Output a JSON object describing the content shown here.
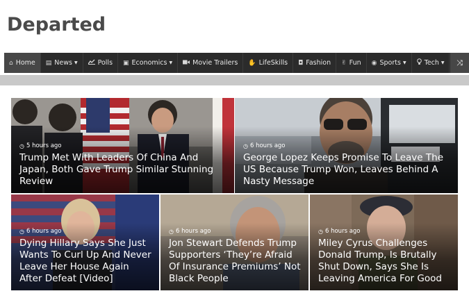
{
  "site": {
    "title": "Departed"
  },
  "nav": {
    "items": [
      {
        "label": "Home",
        "icon": "home-icon",
        "glyph": "⌂",
        "dropdown": false,
        "active": true
      },
      {
        "label": "News",
        "icon": "newspaper-icon",
        "glyph": "▤",
        "dropdown": true,
        "active": false
      },
      {
        "label": "Polls",
        "icon": "line-chart-icon",
        "glyph": "📈",
        "dropdown": false,
        "active": false
      },
      {
        "label": "Economics",
        "icon": "money-icon",
        "glyph": "▣",
        "dropdown": true,
        "active": false
      },
      {
        "label": "Movie Trailers",
        "icon": "video-camera-icon",
        "glyph": "■",
        "dropdown": false,
        "active": false
      },
      {
        "label": "LifeSkills",
        "icon": "hand-icon",
        "glyph": "✋",
        "dropdown": false,
        "active": false
      },
      {
        "label": "Fashion",
        "icon": "shopping-bag-icon",
        "glyph": "◘",
        "dropdown": false,
        "active": false
      },
      {
        "label": "Fun",
        "icon": "hand-peace-icon",
        "glyph": "✌",
        "dropdown": false,
        "active": false
      },
      {
        "label": "Sports",
        "icon": "soccer-ball-icon",
        "glyph": "◉",
        "dropdown": true,
        "active": false
      },
      {
        "label": "Tech",
        "icon": "lightbulb-icon",
        "glyph": "💡",
        "dropdown": true,
        "active": false
      }
    ],
    "shuffle_icon": "shuffle-icon",
    "shuffle_glyph": "⤨"
  },
  "articles": [
    {
      "time": "5 hours ago",
      "headline": "Trump Met With Leaders Of China And Japan, Both Gave Trump Similar Stunning Review"
    },
    {
      "time": "6 hours ago",
      "headline": "George Lopez Keeps Promise To Leave The US Because Trump Won, Leaves Behind A Nasty Message"
    },
    {
      "time": "6 hours ago",
      "headline": "Dying Hillary Says She Just Wants To Curl Up And Never Leave Her House Again After Defeat [Video]"
    },
    {
      "time": "6 hours ago",
      "headline": "Jon Stewart Defends Trump Supporters ‘They’re Afraid Of Insurance Premiums’ Not Black People"
    },
    {
      "time": "6 hours ago",
      "headline": "Miley Cyrus Challenges Donald Trump, Is Brutally Shut Down, Says She Is Leaving America For Good"
    }
  ],
  "colors": {
    "nav_bg": "#2b2b2b",
    "nav_active": "#474747",
    "title": "#4a4a4a",
    "divider_bar": "#c9c9c9"
  }
}
